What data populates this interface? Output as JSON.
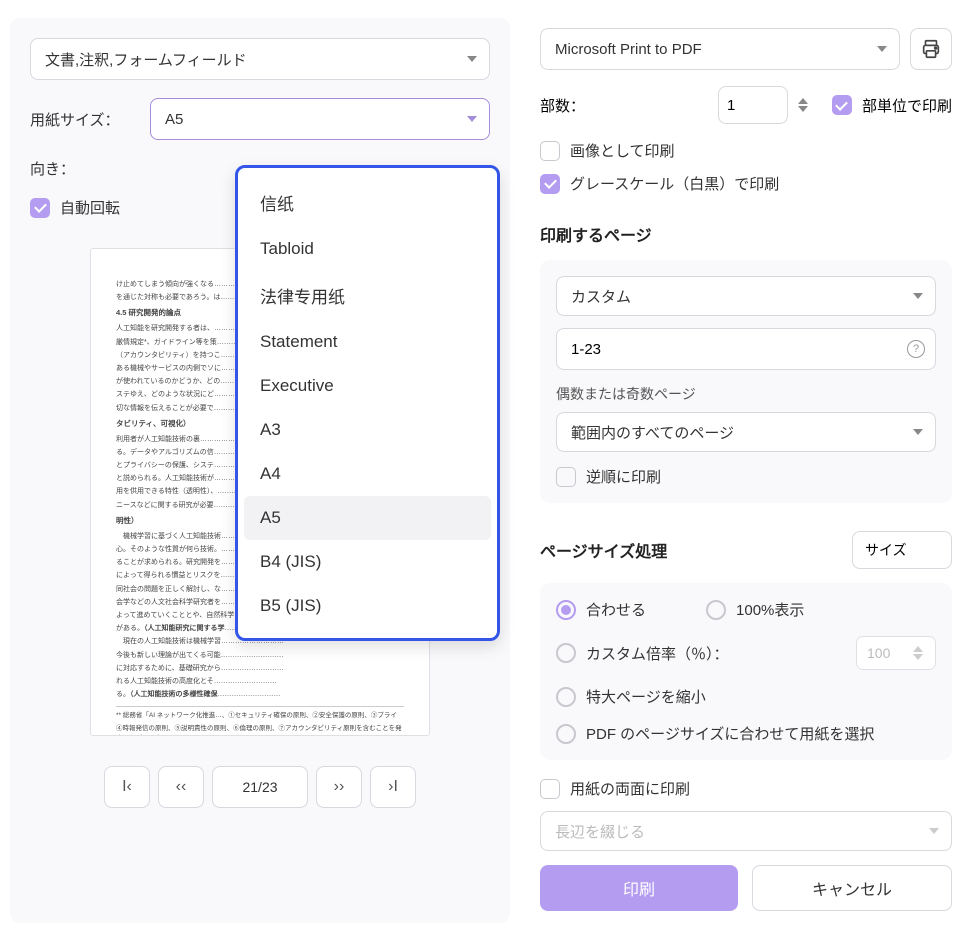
{
  "left": {
    "content_select": "文書,注釈,フォームフィールド",
    "paper_size_label": "用紙サイズ：",
    "paper_size_value": "A5",
    "orientation_label": "向き：",
    "auto_rotate": "自動回転"
  },
  "dropdown_options": [
    "信纸",
    "Tabloid",
    "法律专用纸",
    "Statement",
    "Executive",
    "A3",
    "A4",
    "A5",
    "B4 (JIS)",
    "B5 (JIS)"
  ],
  "dropdown_selected": "A5",
  "pager": {
    "current": "21",
    "total": "23",
    "sep": " / "
  },
  "right": {
    "printer": "Microsoft Print to PDF",
    "copies_label": "部数：",
    "copies_value": "1",
    "collate": "部単位で印刷",
    "print_as_image": "画像として印刷",
    "grayscale": "グレースケール（白黒）で印刷",
    "pages_title": "印刷するページ",
    "range_mode": "カスタム",
    "range_value": "1-23",
    "odd_even_label": "偶数または奇数ページ",
    "odd_even_value": "範囲内のすべてのページ",
    "reverse": "逆順に印刷",
    "sizing_title": "ページサイズ処理",
    "size_mode": "サイズ",
    "fit": "合わせる",
    "actual": "100%表示",
    "custom_scale": "カスタム倍率（％）：",
    "custom_scale_value": "100",
    "shrink": "特大ページを縮小",
    "choose_paper": "PDF のページサイズに合わせて用紙を選択",
    "duplex": "用紙の両面に印刷",
    "binding": "長辺を綴じる",
    "print_btn": "印刷",
    "cancel_btn": "キャンセル"
  }
}
